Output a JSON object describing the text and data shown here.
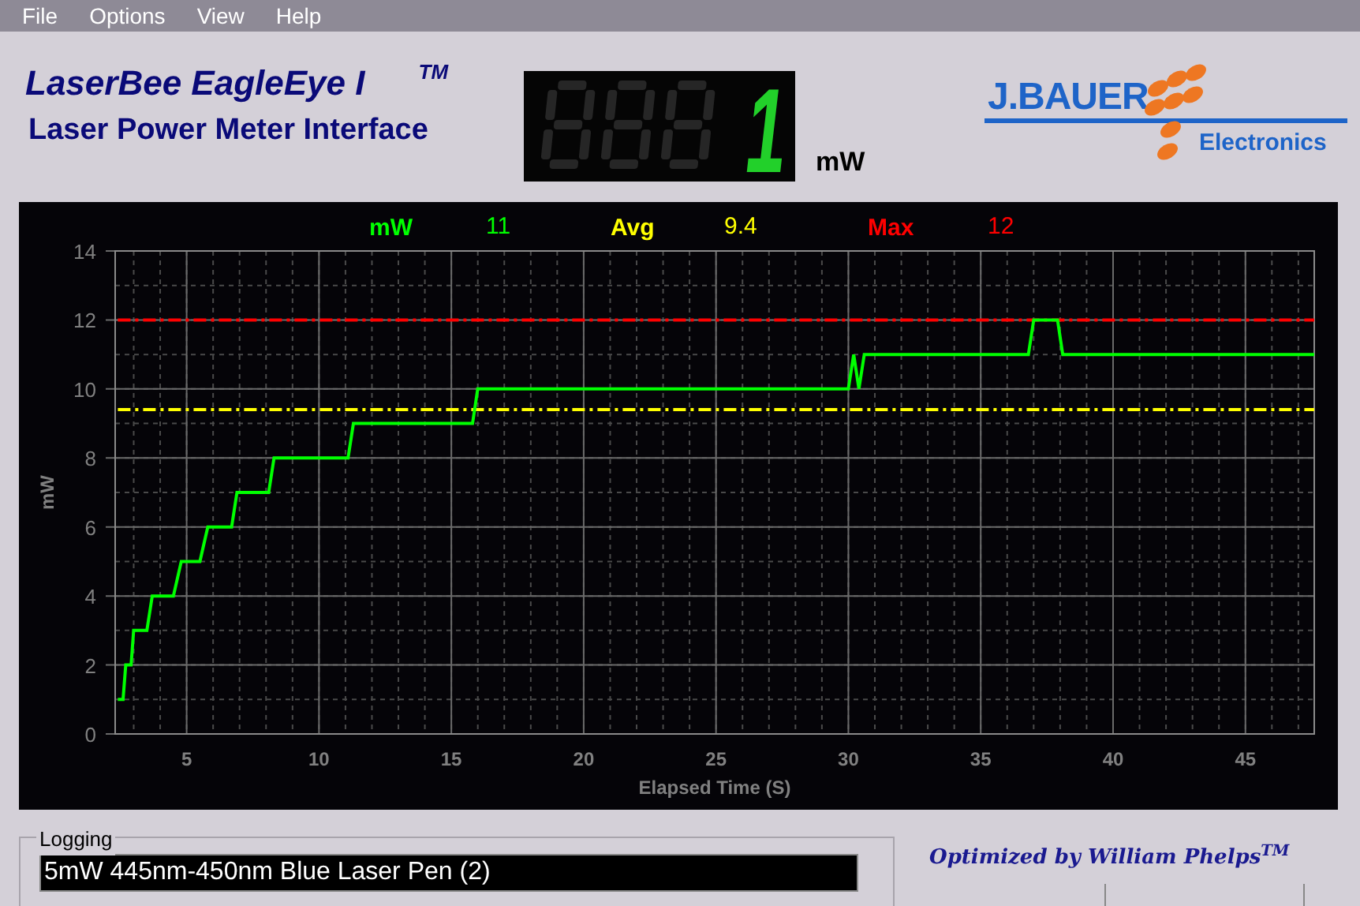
{
  "menu": [
    "File",
    "Options",
    "View",
    "Help"
  ],
  "header": {
    "title": "LaserBee EagleEye I",
    "trademark": "TM",
    "subtitle": "Laser Power Meter Interface"
  },
  "display": {
    "value": "1",
    "unit": "mW"
  },
  "logo": {
    "name": "J.BAUER",
    "tagline": "Electronics"
  },
  "chart": {
    "readouts": [
      {
        "value": "11"
      },
      {
        "value": "9.4"
      },
      {
        "value": "12"
      }
    ],
    "chart_data": {
      "type": "line",
      "xlabel": "Elapsed Time (S)",
      "ylabel": "mW",
      "x": [
        2.4,
        2.6,
        2.7,
        2.9,
        3.0,
        3.5,
        3.7,
        4.5,
        4.8,
        5.5,
        5.8,
        6.7,
        6.9,
        8.1,
        8.3,
        11.1,
        11.3,
        15.8,
        16.0,
        30.0,
        30.2,
        30.4,
        30.6,
        36.8,
        37.0,
        37.9,
        38.1,
        47.6
      ],
      "grid": true,
      "series": [
        {
          "name": "mW",
          "color": "#00ff00",
          "values": [
            1,
            1,
            2,
            2,
            3,
            3,
            4,
            4,
            5,
            5,
            6,
            6,
            7,
            7,
            8,
            8,
            9,
            9,
            10,
            10,
            11,
            10,
            11,
            11,
            12,
            12,
            11,
            11
          ]
        },
        {
          "name": "Avg",
          "color": "#ffff00",
          "line_style": "dashdot",
          "values": [
            9.4,
            9.4,
            9.4,
            9.4,
            9.4,
            9.4,
            9.4,
            9.4,
            9.4,
            9.4,
            9.4,
            9.4,
            9.4,
            9.4,
            9.4,
            9.4,
            9.4,
            9.4,
            9.4,
            9.4,
            9.4,
            9.4,
            9.4,
            9.4,
            9.4,
            9.4,
            9.4,
            9.4
          ]
        },
        {
          "name": "Max",
          "color": "#ff0000",
          "line_style": "dashdot",
          "values": [
            12,
            12,
            12,
            12,
            12,
            12,
            12,
            12,
            12,
            12,
            12,
            12,
            12,
            12,
            12,
            12,
            12,
            12,
            12,
            12,
            12,
            12,
            12,
            12,
            12,
            12,
            12,
            12
          ]
        }
      ],
      "xlim": [
        2.3,
        47.6
      ],
      "ylim": [
        0,
        14
      ],
      "xticks": [
        5,
        10,
        15,
        20,
        25,
        30,
        35,
        40,
        45
      ],
      "yticks": [
        0,
        2,
        4,
        6,
        8,
        10,
        12,
        14
      ]
    }
  },
  "logging": {
    "label": "Logging",
    "value": "5mW 445nm-450nm Blue Laser Pen (2)"
  },
  "credit": "Optimized by William Phelps$^{TM}$"
}
